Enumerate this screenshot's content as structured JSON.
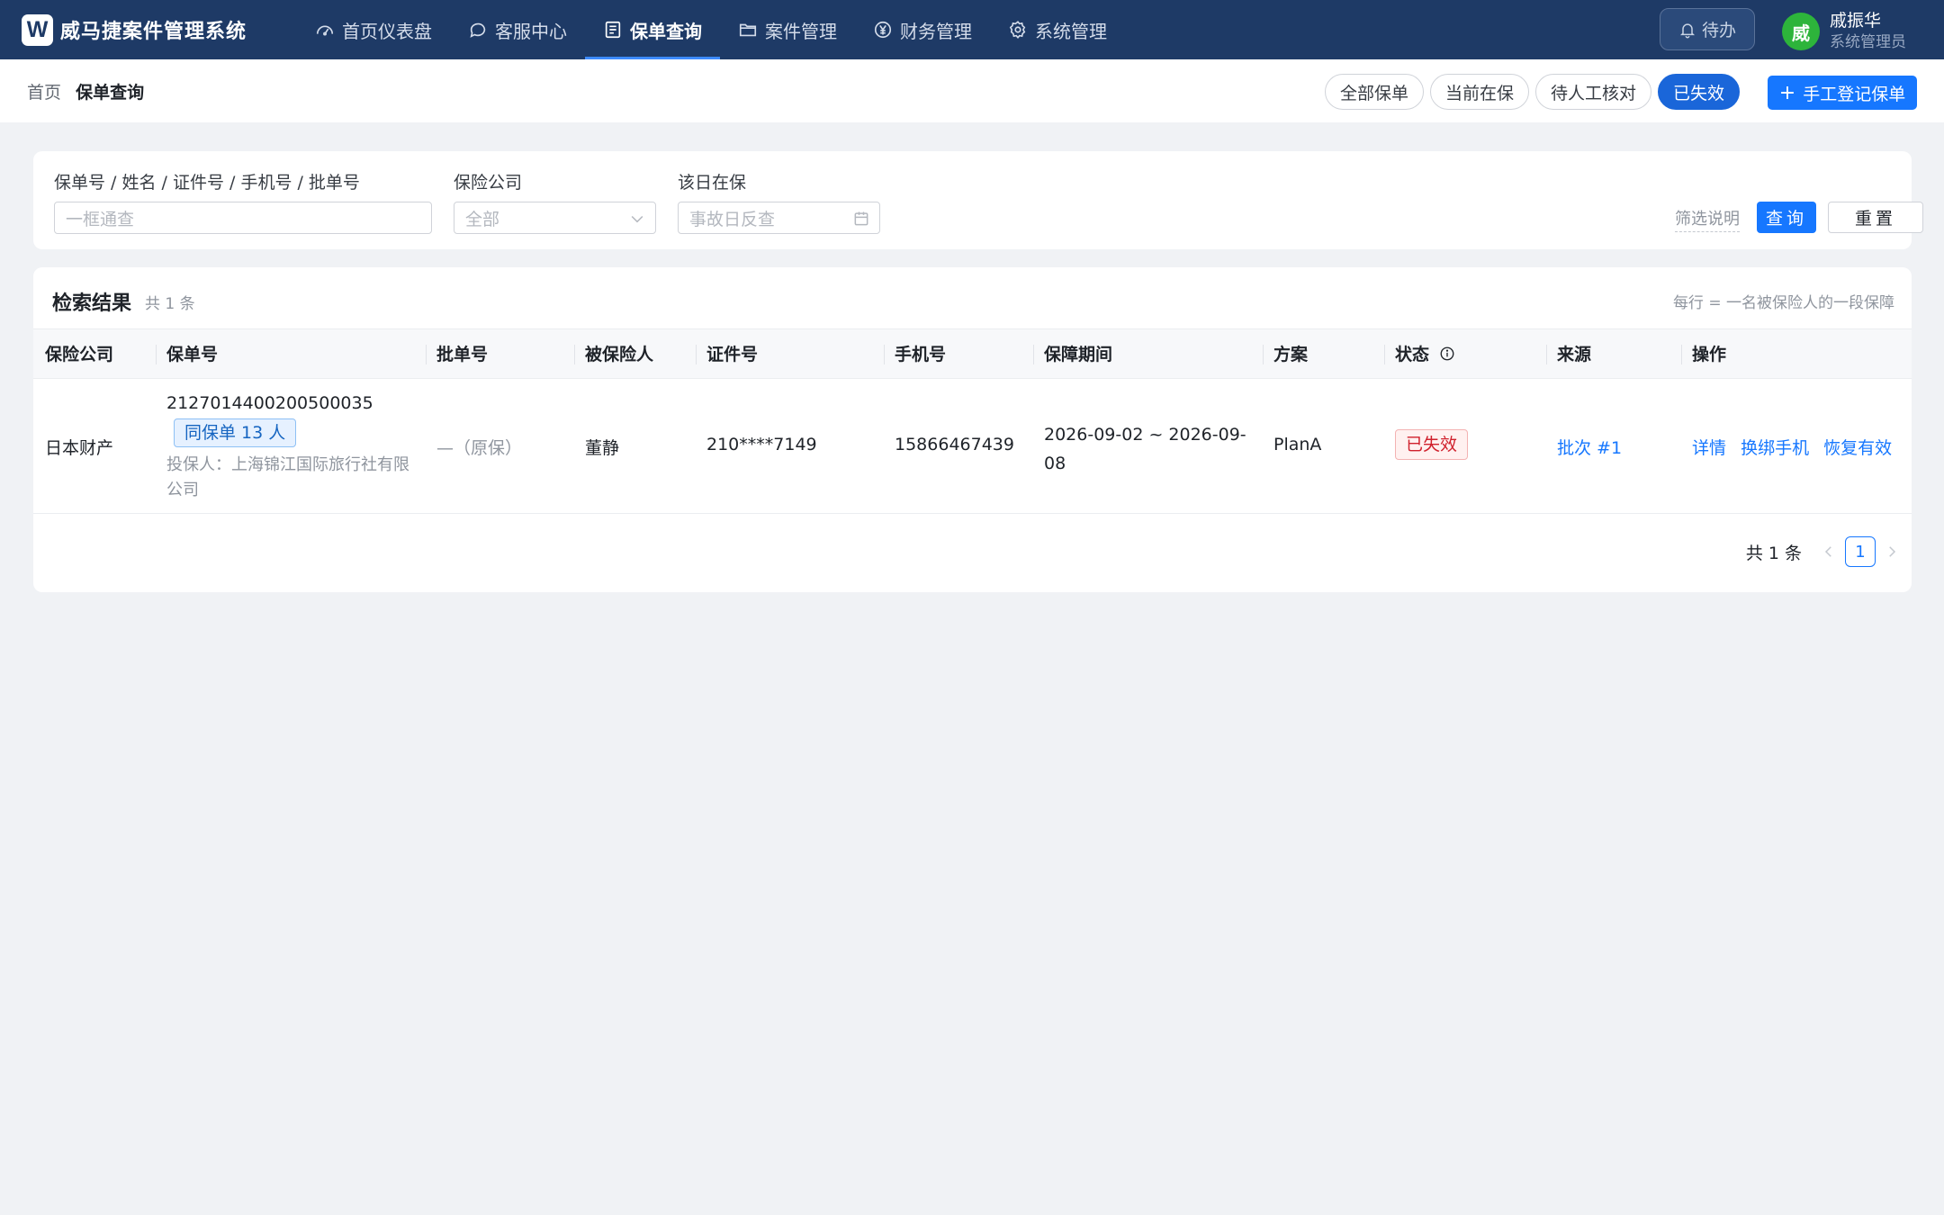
{
  "app": {
    "logo_letter": "W",
    "title": "威马捷案件管理系统"
  },
  "nav": {
    "items": [
      {
        "label": "首页仪表盘",
        "icon": "dashboard-icon"
      },
      {
        "label": "客服中心",
        "icon": "chat-icon"
      },
      {
        "label": "保单查询",
        "icon": "list-icon",
        "active": true
      },
      {
        "label": "案件管理",
        "icon": "folder-icon"
      },
      {
        "label": "财务管理",
        "icon": "yen-icon"
      },
      {
        "label": "系统管理",
        "icon": "gear-icon"
      }
    ],
    "todo_label": "待办",
    "user": {
      "avatar_text": "威",
      "name": "戚振华",
      "role": "系统管理员"
    }
  },
  "breadcrumb": {
    "home": "首页",
    "current": "保单查询"
  },
  "filter_tabs": [
    "全部保单",
    "当前在保",
    "待人工核对",
    "已失效"
  ],
  "filter_tabs_active": "已失效",
  "add_button": {
    "icon": "+",
    "label": "手工登记保单"
  },
  "search": {
    "keyword": {
      "label": "保单号 / 姓名 / 证件号 / 手机号 / 批单号",
      "placeholder": "一框通查"
    },
    "company": {
      "label": "保险公司",
      "value": "全部"
    },
    "date": {
      "label": "该日在保",
      "placeholder": "事故日反查"
    },
    "filter_note": "筛选说明",
    "query_label": "查询",
    "reset_label": "重置"
  },
  "results": {
    "title": "检索结果",
    "count": "共 1 条",
    "note": "每行 = 一名被保险人的一段保障",
    "columns": [
      "保险公司",
      "保单号",
      "批单号",
      "被保险人",
      "证件号",
      "手机号",
      "保障期间",
      "方案",
      "状态",
      "来源",
      "操作"
    ],
    "rows": [
      {
        "company": "日本财产",
        "policy_no": "2127014400200500035",
        "same_policy_tag": "同保单 13 人",
        "policyholder": "投保人：上海锦江国际旅行社有限公司",
        "endorsement": "—（原保）",
        "insured": "董静",
        "id_no": "210****7149",
        "phone": "15866467439",
        "period": "2026-09-02 ~ 2026-09-08",
        "plan": "PlanA",
        "status": "已失效",
        "source": "批次 #1",
        "actions": [
          "详情",
          "换绑手机",
          "恢复有效"
        ]
      }
    ]
  },
  "pagination": {
    "total": "共 1 条",
    "current": "1"
  },
  "colors": {
    "nav_bg": "#1e3a66",
    "primary": "#1677ff",
    "active_tab": "#1a66d9",
    "danger": "#d0212d",
    "page_bg": "#f0f2f5"
  }
}
